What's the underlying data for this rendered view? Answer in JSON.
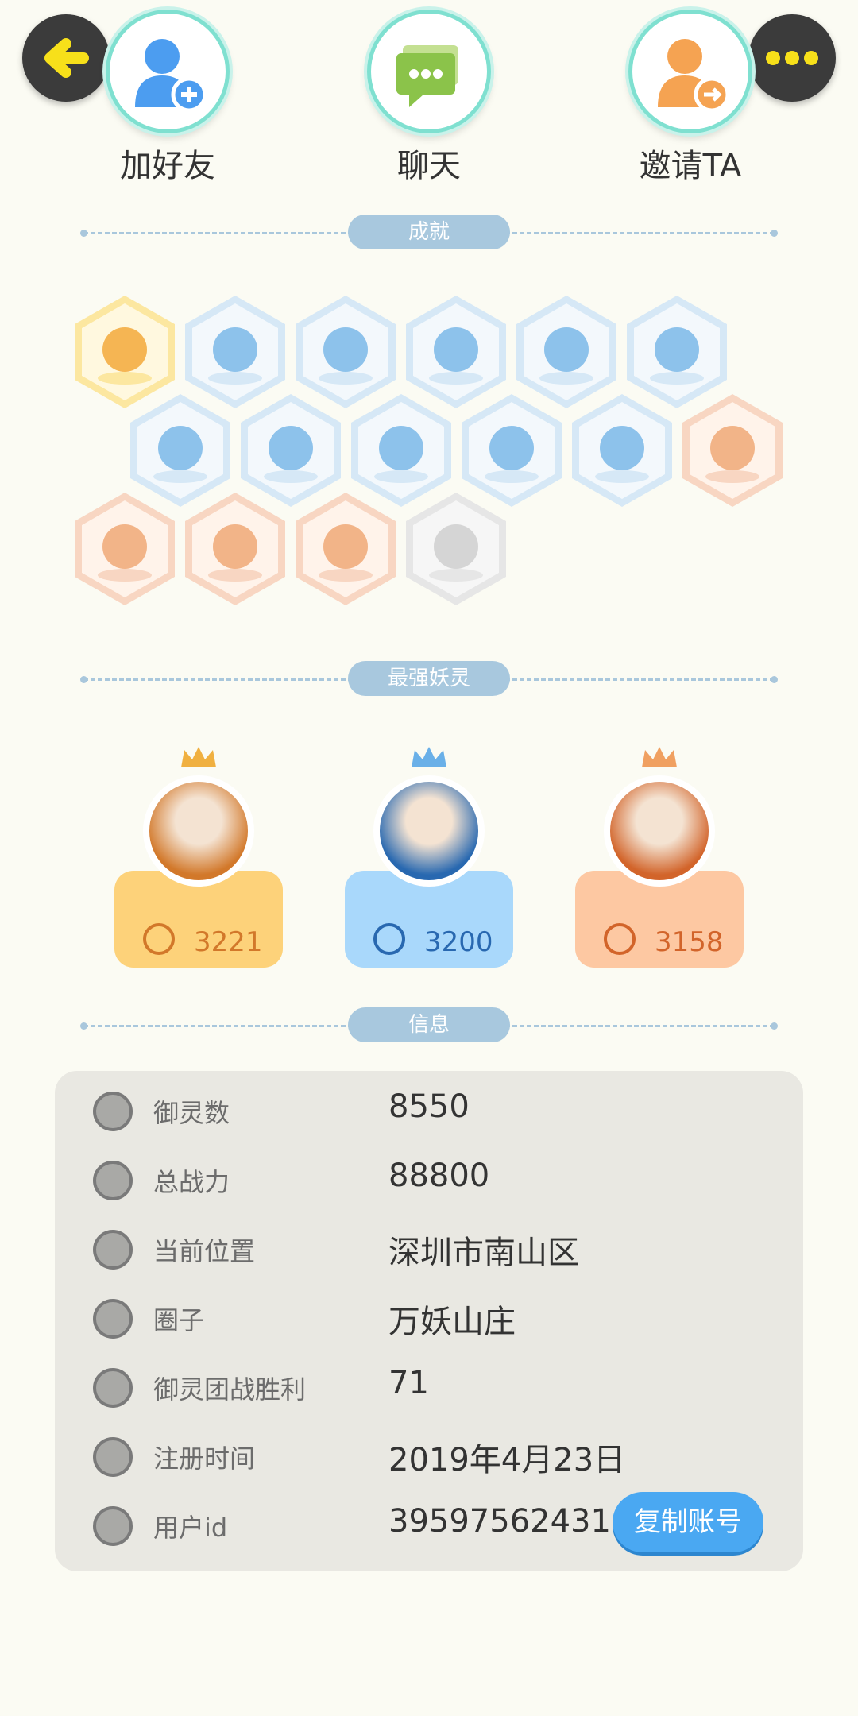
{
  "header": {
    "back_icon": "back-arrow-icon",
    "more_icon": "more-dots-icon",
    "actions": [
      {
        "label": "加好友",
        "icon": "add-friend-icon"
      },
      {
        "label": "聊天",
        "icon": "chat-icon"
      },
      {
        "label": "邀请TA",
        "icon": "invite-icon"
      }
    ]
  },
  "sections": {
    "achievements": "成就",
    "top_spirits": "最强妖灵",
    "info": "信息"
  },
  "achievements": [
    {
      "icon": "cat-badge-icon",
      "tier": "gold"
    },
    {
      "icon": "sneaker-badge-icon",
      "tier": "blue"
    },
    {
      "icon": "target-badge-icon",
      "tier": "blue"
    },
    {
      "icon": "moon-badge-icon",
      "tier": "blue"
    },
    {
      "icon": "orb-badge-icon",
      "tier": "blue"
    },
    {
      "icon": "yinyang-wave-badge-icon",
      "tier": "blue"
    },
    {
      "icon": "monkey-badge-icon",
      "tier": "blue"
    },
    {
      "icon": "stroller-badge-icon",
      "tier": "blue"
    },
    {
      "icon": "yinyang-badge-icon",
      "tier": "blue"
    },
    {
      "icon": "shield-badge-icon",
      "tier": "blue"
    },
    {
      "icon": "figure-badge-icon",
      "tier": "blue"
    },
    {
      "icon": "crystal-badge-icon",
      "tier": "orange"
    },
    {
      "icon": "fox-badge-icon",
      "tier": "orange"
    },
    {
      "icon": "koi-badge-icon",
      "tier": "orange"
    },
    {
      "icon": "demon-badge-icon",
      "tier": "orange"
    },
    {
      "icon": "wolf-book-badge-icon",
      "tier": "grey"
    }
  ],
  "top_spirits": [
    {
      "score": "3221",
      "color": "#fdd27a",
      "accent": "#d2782a",
      "crown": "#f0b040"
    },
    {
      "score": "3200",
      "color": "#a9d8fb",
      "accent": "#2868b0",
      "crown": "#6ab0e8"
    },
    {
      "score": "3158",
      "color": "#fdc8a2",
      "accent": "#d2642a",
      "crown": "#f0a060"
    }
  ],
  "info": {
    "rows": [
      {
        "label": "御灵数",
        "value": "8550",
        "icon": "spirit-count-icon"
      },
      {
        "label": "总战力",
        "value": "88800",
        "icon": "sword-icon"
      },
      {
        "label": "当前位置",
        "value": "深圳市南山区",
        "icon": "location-pin-icon"
      },
      {
        "label": "圈子",
        "value": "万妖山庄",
        "icon": "circle-target-icon"
      },
      {
        "label": "御灵团战胜利",
        "value": "71",
        "icon": "battle-win-icon"
      },
      {
        "label": "注册时间",
        "value": "2019年4月23日",
        "icon": "clock-icon"
      },
      {
        "label": "用户id",
        "value": "39597562431",
        "icon": "id-card-icon"
      }
    ],
    "copy_button": "复制账号"
  }
}
